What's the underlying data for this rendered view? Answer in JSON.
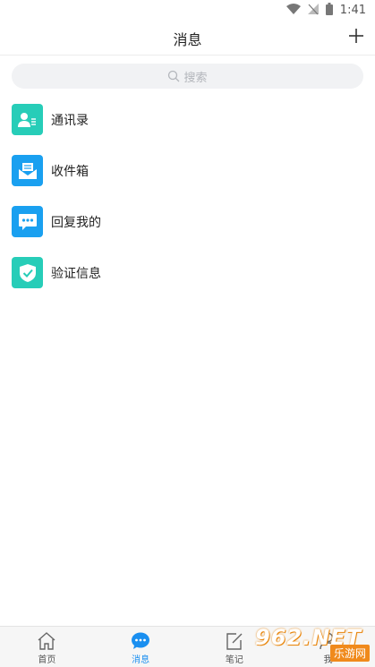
{
  "status_bar": {
    "time": "1:41"
  },
  "header": {
    "title": "消息"
  },
  "search": {
    "placeholder": "搜索"
  },
  "list": [
    {
      "label": "通讯录",
      "icon": "contacts-icon",
      "color": "#27cdb8"
    },
    {
      "label": "收件箱",
      "icon": "inbox-icon",
      "color": "#1aa0f0"
    },
    {
      "label": "回复我的",
      "icon": "reply-chat-icon",
      "color": "#1aa0f0"
    },
    {
      "label": "验证信息",
      "icon": "verify-shield-icon",
      "color": "#27cdb8"
    }
  ],
  "bottom_nav": [
    {
      "label": "首页",
      "icon": "home-icon"
    },
    {
      "label": "消息",
      "icon": "message-icon",
      "active": true
    },
    {
      "label": "笔记",
      "icon": "note-icon"
    },
    {
      "label": "我",
      "icon": "profile-icon"
    }
  ],
  "watermark": {
    "top": "962.NET",
    "bottom": "乐游网"
  },
  "colors": {
    "accent": "#1a8ff0",
    "teal": "#27cdb8",
    "blue": "#1aa0f0"
  }
}
